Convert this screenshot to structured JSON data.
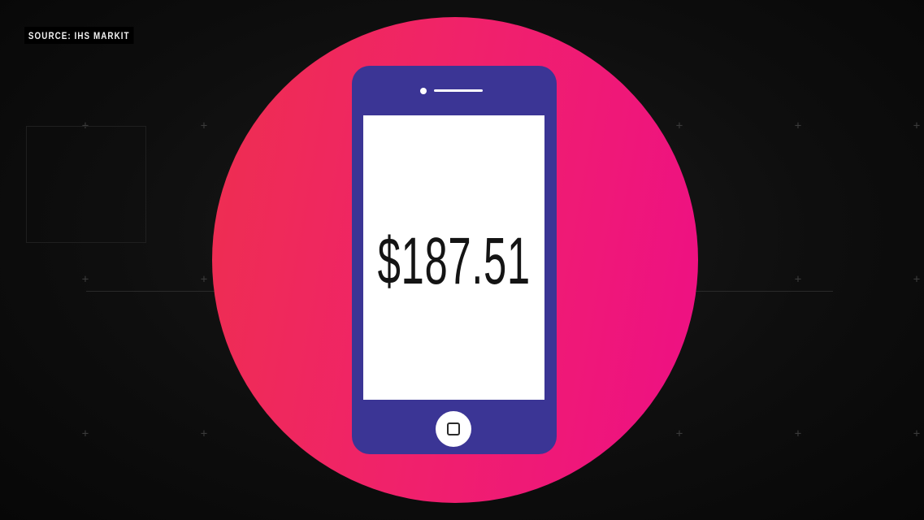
{
  "source": {
    "label": "SOURCE: IHS MARKIT"
  },
  "phone": {
    "screen_text": "$187.51"
  },
  "colors": {
    "background": "#0b0b0b",
    "circle_left": "#ee2f4f",
    "circle_right": "#ee0f85",
    "phone_body": "#3b3595",
    "screen": "#ffffff",
    "price_text": "#141414"
  },
  "icons": {
    "home_button": "home-button-icon",
    "speaker": "speaker-icon",
    "grid_marker": "plus-icon"
  }
}
